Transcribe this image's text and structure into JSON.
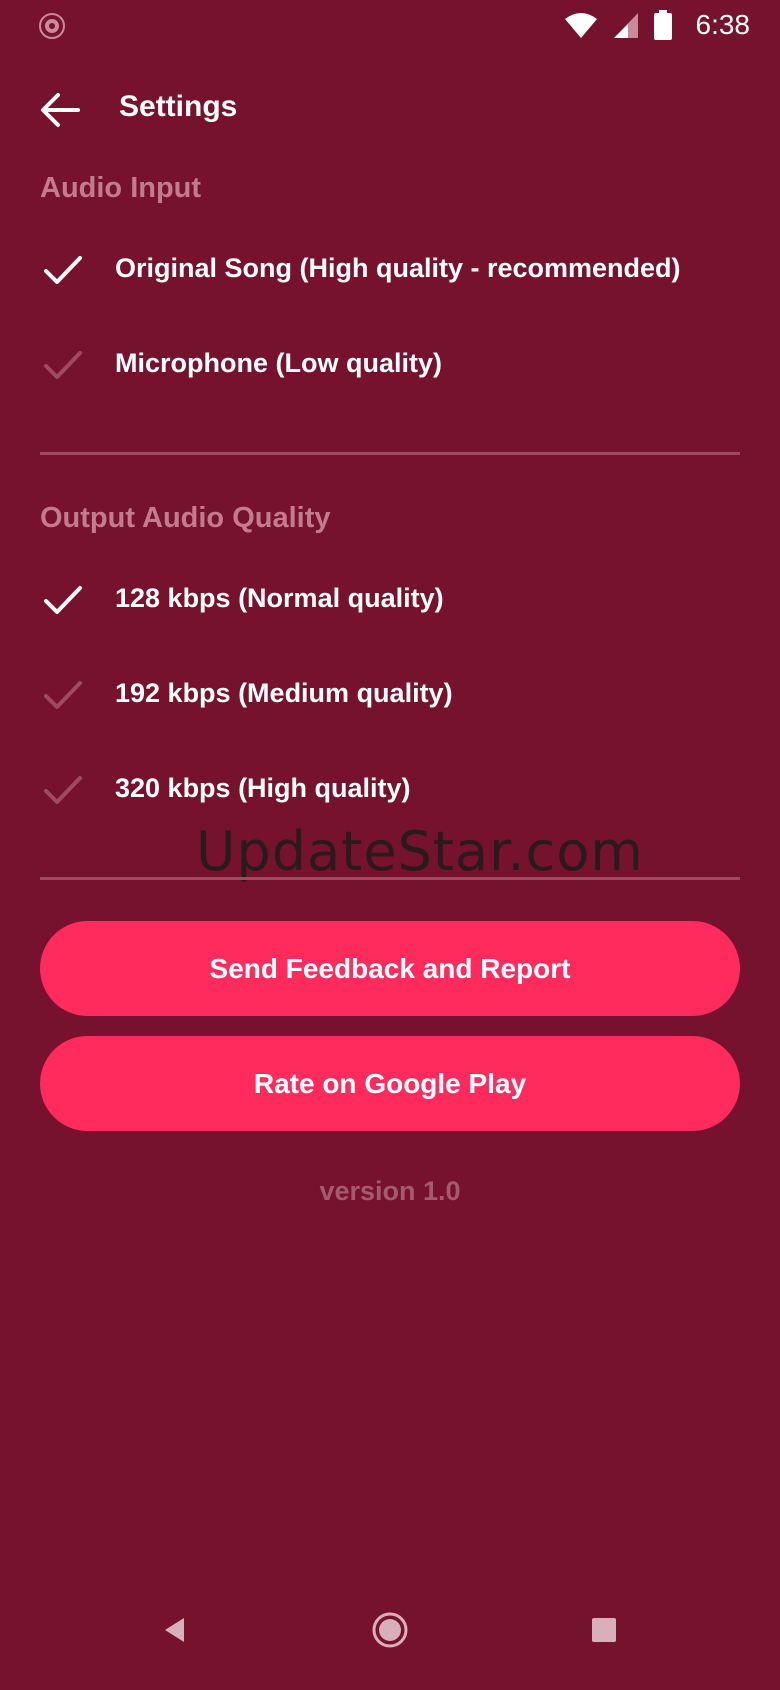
{
  "status_bar": {
    "time": "6:38",
    "icons": [
      "app-spinner-icon",
      "wifi-icon",
      "cell-signal-icon",
      "battery-icon"
    ]
  },
  "toolbar": {
    "back_icon": "arrow-left-icon",
    "title": "Settings"
  },
  "audio_input": {
    "header": "Audio Input",
    "options": [
      {
        "label": "Original Song (High quality - recommended)",
        "selected": true
      },
      {
        "label": "Microphone (Low quality)",
        "selected": false
      }
    ]
  },
  "output_quality": {
    "header": "Output Audio Quality",
    "options": [
      {
        "label": "128 kbps (Normal quality)",
        "selected": true
      },
      {
        "label": "192 kbps (Medium quality)",
        "selected": false
      },
      {
        "label": "320 kbps (High quality)",
        "selected": false
      }
    ]
  },
  "watermark": "UpdateStar.com",
  "buttons": {
    "feedback": "Send Feedback and Report",
    "rate": "Rate on Google Play"
  },
  "version": "version 1.0",
  "nav_bar": {
    "icons": [
      "back-triangle-icon",
      "home-circle-icon",
      "recents-square-icon"
    ]
  },
  "colors": {
    "background": "#76122d",
    "accent": "#ff2b5c",
    "section_header": "#c37b8f",
    "check_selected": "#ffffff",
    "check_unselected": "#a04a62"
  }
}
